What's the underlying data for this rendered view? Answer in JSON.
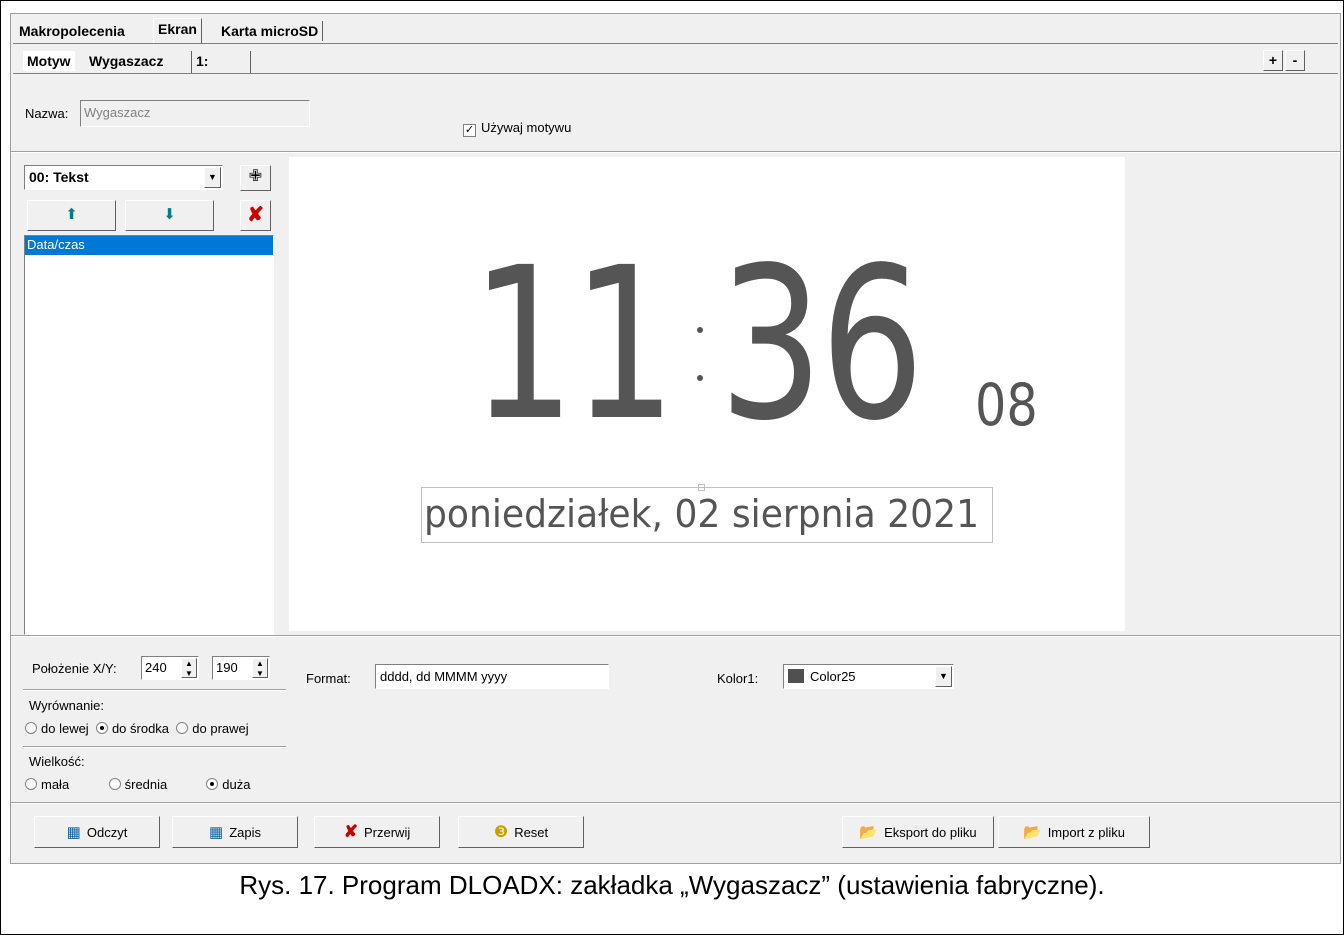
{
  "tabs": [
    "Makropolecenia",
    "Ekran",
    "Karta microSD"
  ],
  "subtabs": [
    "Motyw",
    "Wygaszacz",
    "1:"
  ],
  "plus_label": "+",
  "minus_label": "-",
  "name_label": "Nazwa:",
  "name_value": "Wygaszacz",
  "use_theme_label": "Używaj motywu",
  "use_theme_checked": true,
  "element_select": "00: Tekst",
  "element_list": [
    "Data/czas"
  ],
  "preview": {
    "hours": "11",
    "colon": ":",
    "minutes": "36",
    "seconds": "08",
    "date": "poniedziałek, 02 sierpnia 2021"
  },
  "position_label": "Położenie X/Y:",
  "pos_x": "240",
  "pos_y": "190",
  "format_label": "Format:",
  "format_value": "dddd, dd MMMM yyyy",
  "color_label": "Kolor1:",
  "color_value": "Color25",
  "color_swatch": "#505050",
  "align_label": "Wyrównanie:",
  "align_options": [
    "do lewej",
    "do środka",
    "do prawej"
  ],
  "align_selected": 1,
  "size_label": "Wielkość:",
  "size_options": [
    "mała",
    "średnia",
    "duża"
  ],
  "size_selected": 2,
  "buttons": {
    "read": "Odczyt",
    "save": "Zapis",
    "abort": "Przerwij",
    "reset": "Reset",
    "export": "Eksport do pliku",
    "import": "Import z pliku"
  },
  "caption": "Rys. 17. Program DLOADX: zakładka „Wygaszacz” (ustawienia fabryczne)."
}
